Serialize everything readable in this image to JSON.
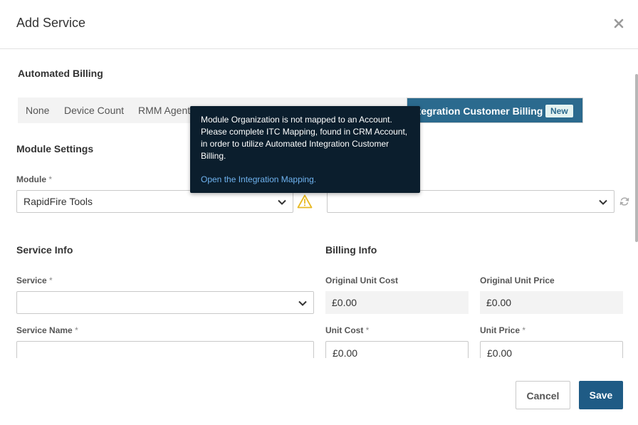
{
  "dialog": {
    "title": "Add Service"
  },
  "automated_billing": {
    "title": "Automated Billing",
    "tabs": [
      {
        "label": "None"
      },
      {
        "label": "Device Count"
      },
      {
        "label": "RMM Agent"
      },
      {
        "label": "ntegration Customer Billing",
        "badge": "New",
        "active": true
      }
    ]
  },
  "module_settings": {
    "title": "Module Settings",
    "module_label": "Module",
    "required_mark": "*",
    "module_value": "RapidFire Tools",
    "second_select_value": ""
  },
  "tooltip": {
    "text": "Module Organization is not mapped to an Account. Please complete ITC Mapping, found in CRM Account, in order to utilize Automated Integration Customer Billing.",
    "link": "Open the Integration Mapping."
  },
  "service_info": {
    "title": "Service Info",
    "service_label": "Service",
    "service_value": "",
    "service_name_label": "Service Name",
    "service_name_value": ""
  },
  "billing_info": {
    "title": "Billing Info",
    "original_unit_cost_label": "Original Unit Cost",
    "original_unit_cost": "£0.00",
    "original_unit_price_label": "Original Unit Price",
    "original_unit_price": "£0.00",
    "unit_cost_label": "Unit Cost",
    "unit_cost": "£0.00",
    "unit_price_label": "Unit Price",
    "unit_price": "£0.00"
  },
  "footer": {
    "cancel_label": "Cancel",
    "save_label": "Save"
  },
  "colors": {
    "accent": "#2b6a8e",
    "save_button": "#1f5b85",
    "tooltip_bg": "#0b1e2d",
    "warning": "#e8b923",
    "link": "#6fb3f0"
  }
}
